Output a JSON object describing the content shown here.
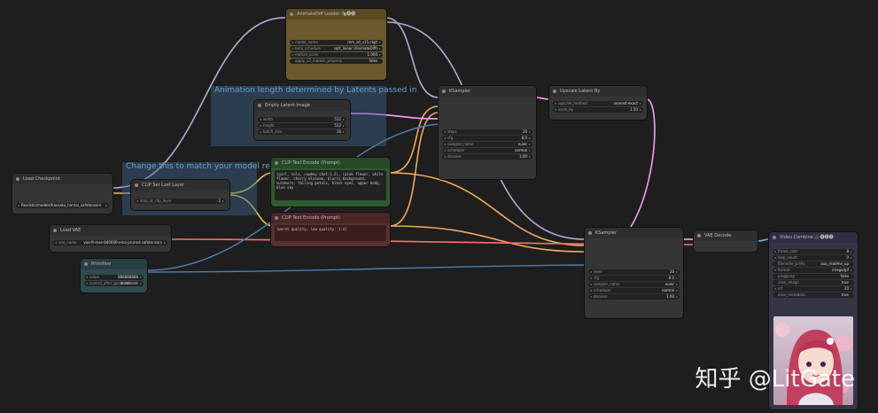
{
  "groups": {
    "animation": {
      "title": "Animation length determined by Latents passed in",
      "color": "#3b6a8f"
    },
    "model": {
      "title": "Change this to match your model reqs",
      "color": "#3b6a8f"
    }
  },
  "nodes": {
    "animatediff": {
      "title": "AnimateDiff Loader 🎭🅐🅓",
      "color": "#6b5a2e",
      "inputs": [
        "model",
        "context_options",
        "motion_lora",
        "ad_settings",
        "ad_keyframes",
        "sample_settings"
      ],
      "widgets": [
        {
          "label": "model_name",
          "value": "mm_sd_v15.ckpt"
        },
        {
          "label": "beta_schedule",
          "value": "sqrt_linear (AnimateDiff)"
        },
        {
          "label": "motion_scale",
          "value": "1.000"
        },
        {
          "label": "apply_v2_models_properly",
          "value": "false"
        }
      ]
    },
    "empty_latent": {
      "title": "Empty Latent Image",
      "widgets": [
        {
          "label": "width",
          "value": "512"
        },
        {
          "label": "height",
          "value": "512"
        },
        {
          "label": "batch_size",
          "value": "16"
        }
      ]
    },
    "ksampler1": {
      "title": "KSampler",
      "widgets": [
        {
          "label": "steps",
          "value": "20"
        },
        {
          "label": "cfg",
          "value": "8.0"
        },
        {
          "label": "sampler_name",
          "value": "euler"
        },
        {
          "label": "scheduler",
          "value": "normal"
        },
        {
          "label": "denoise",
          "value": "1.00"
        }
      ]
    },
    "upscale": {
      "title": "Upscale Latent By",
      "widgets": [
        {
          "label": "upscale_method",
          "value": "nearest-exact"
        },
        {
          "label": "scale_by",
          "value": "1.50"
        }
      ]
    },
    "checkpoint": {
      "title": "Load Checkpoint",
      "widgets": [
        {
          "label": "ckpt_name",
          "value": "Realistic/models/hassaku_hentai_safetensors"
        }
      ]
    },
    "clip_set_last": {
      "title": "CLIP Set Last Layer",
      "widgets": [
        {
          "label": "stop_at_clip_layer",
          "value": "-2"
        }
      ]
    },
    "clip_pos": {
      "title": "CLIP Text Encode (Prompt)",
      "color": "#2f5a2f",
      "text": "(girl, solo, cowboy shot:1.2), (pink flower, white flower, cherry blossom, blurry background, outdoors, falling petals, black eyes, upper body, blue sky"
    },
    "clip_neg": {
      "title": "CLIP Text Encode (Prompt)",
      "color": "#5a2f2f",
      "text": "(worst quality, low quality: 1.4)"
    },
    "vae_loader": {
      "title": "Load VAE",
      "widgets": [
        {
          "label": "vae_name",
          "value": "vae-ft-mse-840000-ema-pruned.safetensors"
        }
      ]
    },
    "primitive": {
      "title": "Primitive",
      "widgets": [
        {
          "label": "value",
          "value": "888888888"
        },
        {
          "label": "control_after_generate",
          "value": "increment"
        }
      ]
    },
    "ksampler2": {
      "title": "KSampler",
      "widgets": [
        {
          "label": "seed",
          "value": "20"
        },
        {
          "label": "cfg",
          "value": "8.0"
        },
        {
          "label": "sampler_name",
          "value": "euler"
        },
        {
          "label": "scheduler",
          "value": "normal"
        },
        {
          "label": "denoise",
          "value": "1.00"
        }
      ]
    },
    "vae_decode": {
      "title": "VAE Decode"
    },
    "video_combine": {
      "title": "Video Combine 🎥🅥🅗🅢",
      "color": "#3a3a55",
      "widgets": [
        {
          "label": "frame_rate",
          "value": "8"
        },
        {
          "label": "loop_count",
          "value": "0"
        },
        {
          "label": "filename_prefix",
          "value": "aaa_readme_up"
        },
        {
          "label": "format",
          "value": "image/gif"
        },
        {
          "label": "pingpong",
          "value": "false"
        },
        {
          "label": "save_image",
          "value": "true"
        },
        {
          "label": "crf",
          "value": "20"
        },
        {
          "label": "save_metadata",
          "value": "true"
        }
      ]
    }
  },
  "watermark": "知乎 @LitGate"
}
